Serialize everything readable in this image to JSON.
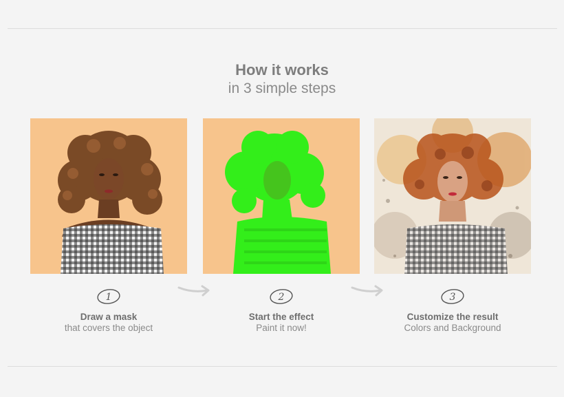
{
  "heading": {
    "title": "How it works",
    "subtitle": "in 3 simple steps"
  },
  "steps": [
    {
      "number": "1",
      "title": "Draw a mask",
      "subtitle": "that covers the object",
      "image": "portrait-photo"
    },
    {
      "number": "2",
      "title": "Start the effect",
      "subtitle": "Paint it now!",
      "image": "portrait-green-mask"
    },
    {
      "number": "3",
      "title": "Customize the result",
      "subtitle": "Colors and Background",
      "image": "portrait-watercolor-effect"
    }
  ],
  "colors": {
    "background": "#f4f4f4",
    "photo_backdrop": "#f7c48c",
    "mask_green": "#33ee1a",
    "text_dark": "#6e6e6e",
    "text_light": "#8a8a8a"
  },
  "icons": [
    "arrow-right-icon",
    "number-1-icon",
    "number-2-icon",
    "number-3-icon"
  ]
}
